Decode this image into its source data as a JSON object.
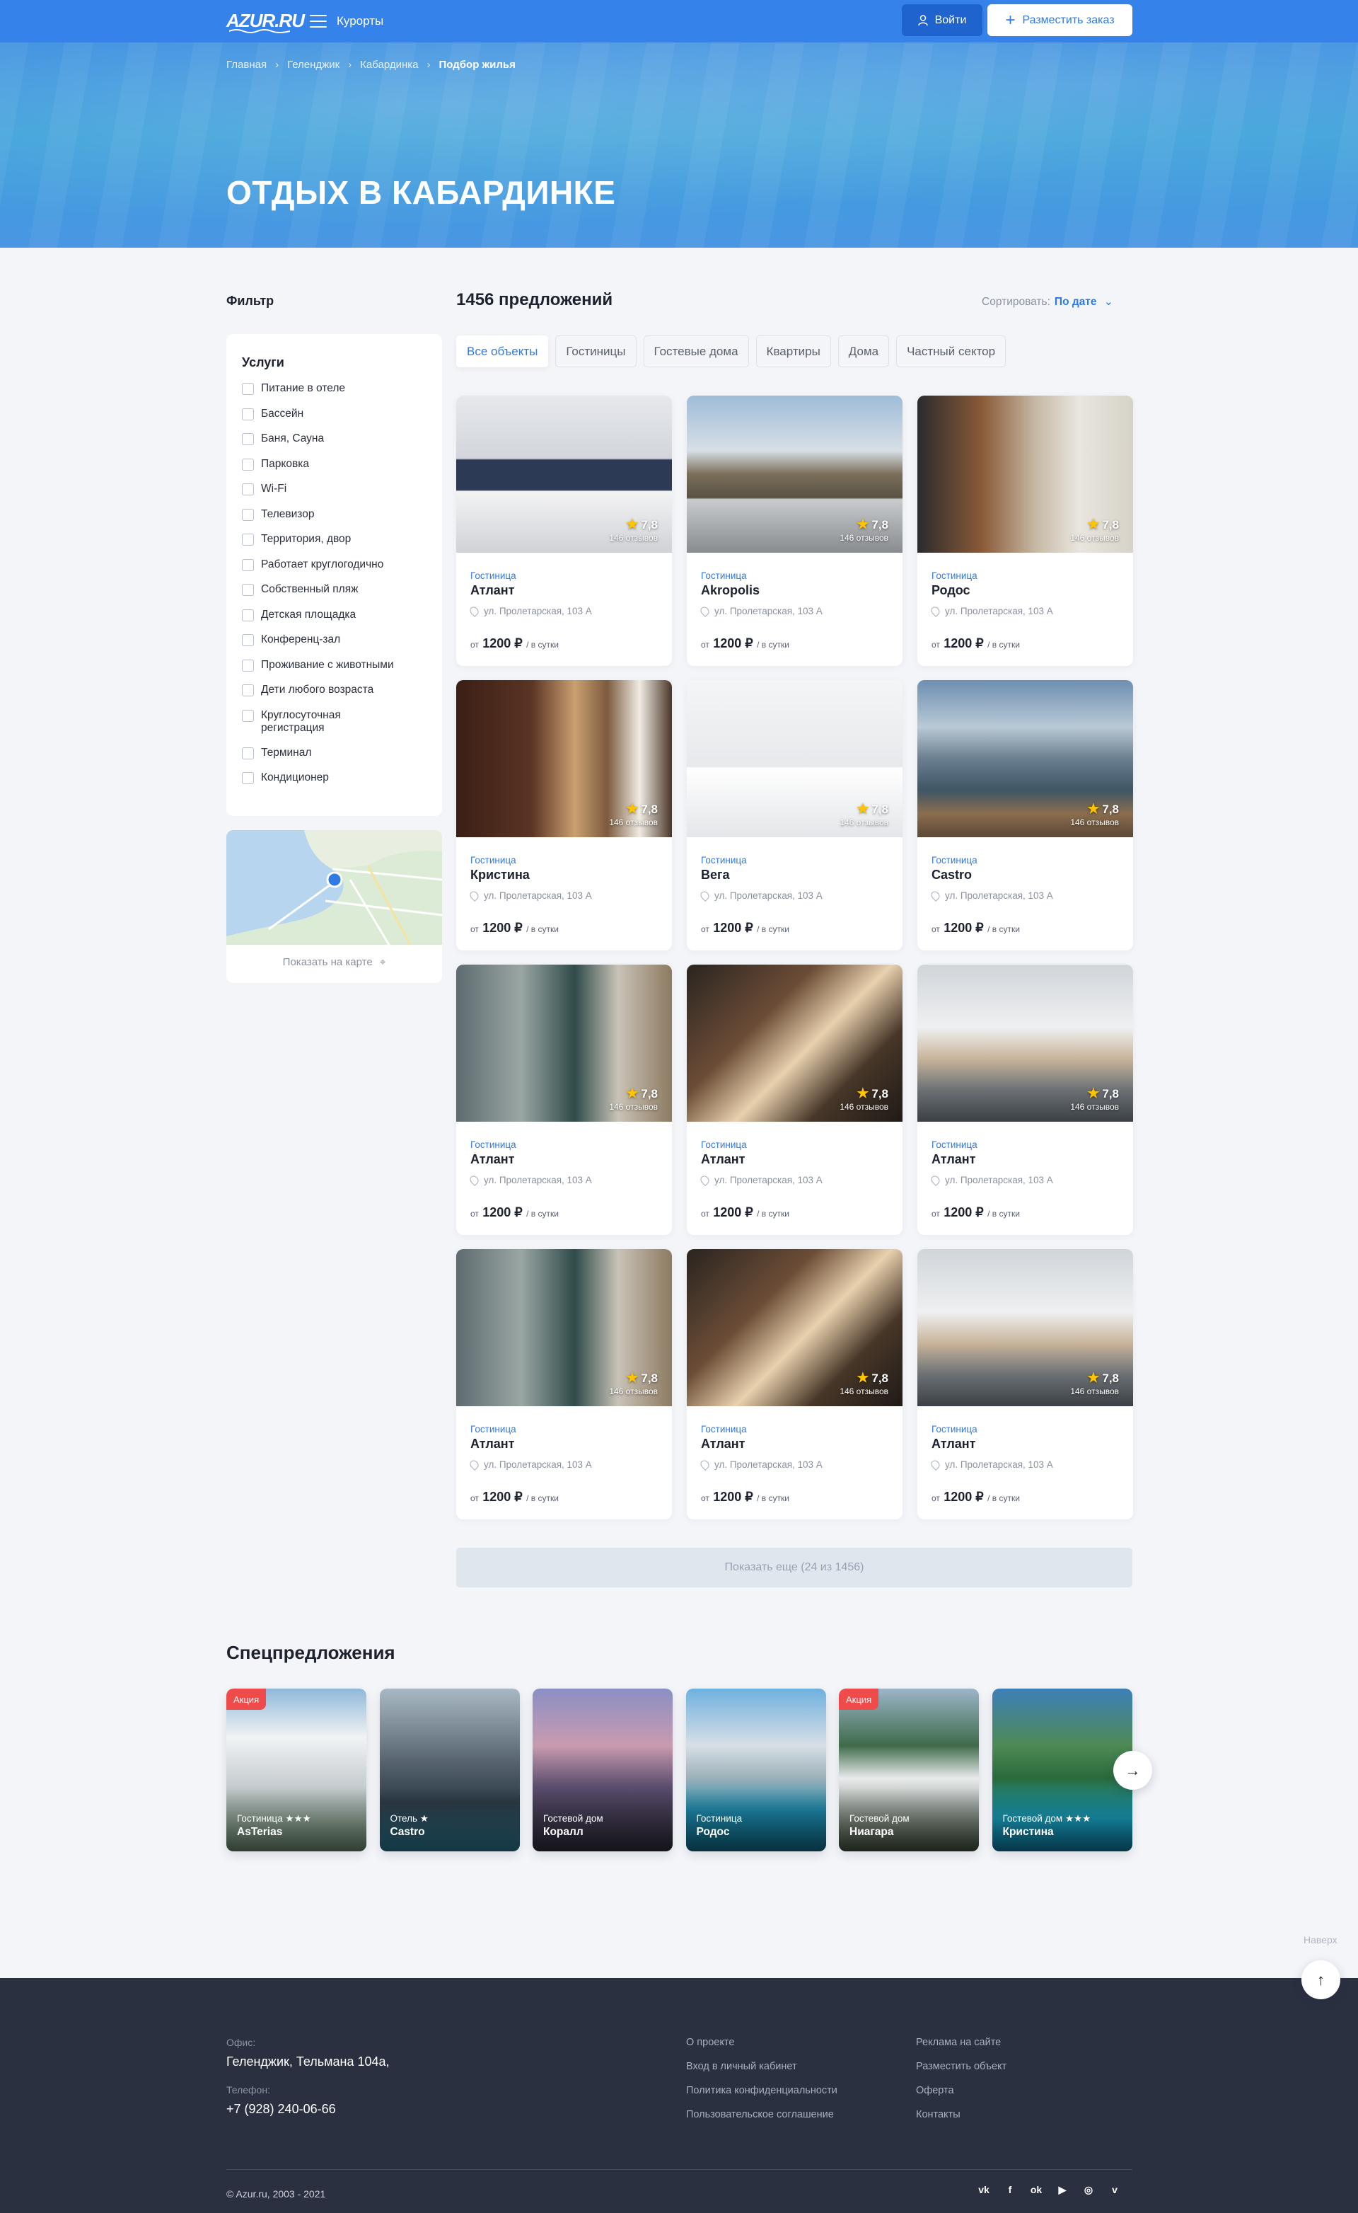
{
  "header": {
    "logo": "AZUR.RU",
    "menu_label": "Курорты",
    "login_label": "Войти",
    "post_label": "Разместить заказ"
  },
  "breadcrumb": [
    "Главная",
    "Геленджик",
    "Кабардинка",
    "Подбор жилья"
  ],
  "hero_title": "ОТДЫХ В КАБАРДИНКЕ",
  "filter": {
    "title": "Фильтр",
    "services_title": "Услуги",
    "services": [
      "Питание в отеле",
      "Бассейн",
      "Баня, Сауна",
      "Парковка",
      "Wi-Fi",
      "Телевизор",
      "Территория, двор",
      "Работает круглогодично",
      "Собственный пляж",
      "Детская площадка",
      "Конференц-зал",
      "Проживание с животными",
      "Дети любого возраста",
      "Круглосуточная регистрация",
      "Терминал",
      "Кондиционер"
    ],
    "map_link": "Показать на карте"
  },
  "results": {
    "count": "1456 предложений",
    "sort_label": "Сортировать:",
    "sort_value": "По дате",
    "tabs": [
      "Все объекты",
      "Гостиницы",
      "Гостевые дома",
      "Квартиры",
      "Дома",
      "Частный сектор"
    ],
    "active_tab": "Все объекты",
    "more_label": "Показать еще (24 из 1456)"
  },
  "cards": [
    {
      "type": "Гостиница",
      "name": "Атлант",
      "rating": "7,8",
      "reviews": "146 отзывов",
      "address": "ул. Пролетарская, 103 А",
      "price_prefix": "от",
      "price": "1200 ₽",
      "price_suffix": "/ в сутки",
      "scene": "bedroom-dark"
    },
    {
      "type": "Гостиница",
      "name": "Akropolis",
      "rating": "7,8",
      "reviews": "146 отзывов",
      "address": "ул. Пролетарская, 103 А",
      "price_prefix": "от",
      "price": "1200 ₽",
      "price_suffix": "/ в сутки",
      "scene": "terrace"
    },
    {
      "type": "Гостиница",
      "name": "Родос",
      "rating": "7,8",
      "reviews": "146 отзывов",
      "address": "ул. Пролетарская, 103 А",
      "price_prefix": "от",
      "price": "1200 ₽",
      "price_suffix": "/ в сутки",
      "scene": "pool-indoor"
    },
    {
      "type": "Гостиница",
      "name": "Кристина",
      "rating": "7,8",
      "reviews": "146 отзывов",
      "address": "ул. Пролетарская, 103 А",
      "price_prefix": "от",
      "price": "1200 ₽",
      "price_suffix": "/ в сутки",
      "scene": "lounge"
    },
    {
      "type": "Гостиница",
      "name": "Вега",
      "rating": "7,8",
      "reviews": "146 отзывов",
      "address": "ул. Пролетарская, 103 А",
      "price_prefix": "от",
      "price": "1200 ₽",
      "price_suffix": "/ в сутки",
      "scene": "bedroom-white"
    },
    {
      "type": "Гостиница",
      "name": "Castro",
      "rating": "7,8",
      "reviews": "146 отзывов",
      "address": "ул. Пролетарская, 103 А",
      "price_prefix": "от",
      "price": "1200 ₽",
      "price_suffix": "/ в сутки",
      "scene": "mountain"
    },
    {
      "type": "Гостиница",
      "name": "Атлант",
      "rating": "7,8",
      "reviews": "146 отзывов",
      "address": "ул. Пролетарская, 103 А",
      "price_prefix": "от",
      "price": "1200 ₽",
      "price_suffix": "/ в сутки",
      "scene": "bedroom-glass"
    },
    {
      "type": "Гостиница",
      "name": "Атлант",
      "rating": "7,8",
      "reviews": "146 отзывов",
      "address": "ул. Пролетарская, 103 А",
      "price_prefix": "от",
      "price": "1200 ₽",
      "price_suffix": "/ в сутки",
      "scene": "bedroom-sun"
    },
    {
      "type": "Гостиница",
      "name": "Атлант",
      "rating": "7,8",
      "reviews": "146 отзывов",
      "address": "ул. Пролетарская, 103 А",
      "price_prefix": "от",
      "price": "1200 ₽",
      "price_suffix": "/ в сутки",
      "scene": "loft"
    },
    {
      "type": "Гостиница",
      "name": "Атлант",
      "rating": "7,8",
      "reviews": "146 отзывов",
      "address": "ул. Пролетарская, 103 А",
      "price_prefix": "от",
      "price": "1200 ₽",
      "price_suffix": "/ в сутки",
      "scene": "bedroom-glass"
    },
    {
      "type": "Гостиница",
      "name": "Атлант",
      "rating": "7,8",
      "reviews": "146 отзывов",
      "address": "ул. Пролетарская, 103 А",
      "price_prefix": "от",
      "price": "1200 ₽",
      "price_suffix": "/ в сутки",
      "scene": "bedroom-sun"
    },
    {
      "type": "Гостиница",
      "name": "Атлант",
      "rating": "7,8",
      "reviews": "146 отзывов",
      "address": "ул. Пролетарская, 103 А",
      "price_prefix": "от",
      "price": "1200 ₽",
      "price_suffix": "/ в сутки",
      "scene": "loft"
    }
  ],
  "special": {
    "title": "Спецпредложения",
    "items": [
      {
        "badge": "Акция",
        "type": "Гостиница ★★★",
        "name": "AsTerias",
        "scene": "building-white"
      },
      {
        "badge": "",
        "type": "Отель ★",
        "name": "Castro",
        "scene": "city-pool"
      },
      {
        "badge": "",
        "type": "Гостевой дом",
        "name": "Коралл",
        "scene": "palms-dusk"
      },
      {
        "badge": "",
        "type": "Гостиница",
        "name": "Родос",
        "scene": "resort-pool"
      },
      {
        "badge": "Акция",
        "type": "Гостевой дом",
        "name": "Ниагара",
        "scene": "hotel-hill"
      },
      {
        "badge": "",
        "type": "Гостевой дом ★★★",
        "name": "Кристина",
        "scene": "palms-pool"
      }
    ]
  },
  "back_to_top": "Наверх",
  "footer": {
    "office_label": "Офис:",
    "office_value": "Геленджик, Тельмана 104а,",
    "phone_label": "Телефон:",
    "phone_value": "+7 (928) 240-06-66",
    "links_col1": [
      "О проекте",
      "Вход в личный кабинет",
      "Политика конфиденциальности",
      "Пользовательское соглашение"
    ],
    "links_col2": [
      "Реклама на сайте",
      "Разместить объект",
      "Оферта",
      "Контакты"
    ],
    "copyright": "© Azur.ru, 2003 - 2021",
    "social": [
      "vk-icon",
      "facebook-icon",
      "odnoklassniki-icon",
      "youtube-icon",
      "instagram-icon",
      "vimeo-icon"
    ]
  },
  "colors": {
    "accent": "#3583ea",
    "footer": "#2b3041",
    "badge": "#f04b4b"
  }
}
